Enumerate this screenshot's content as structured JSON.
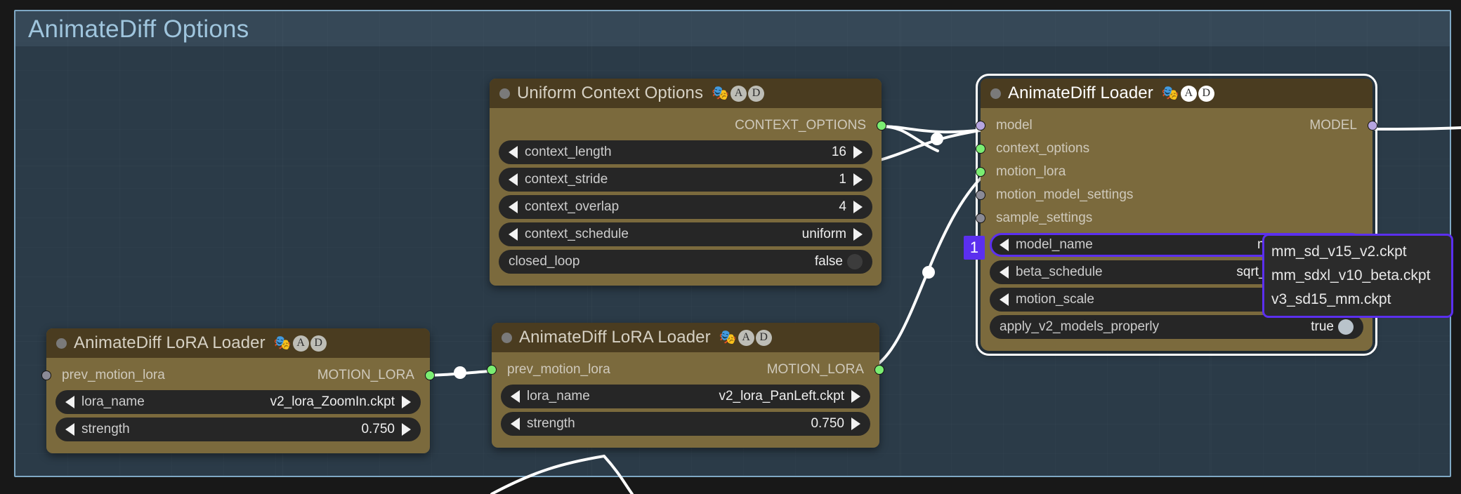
{
  "canvas": {
    "background_color": "#181818"
  },
  "group": {
    "title": "AnimateDiff Options",
    "border_color": "#7fa8c4",
    "fill_color": "#2b3b48"
  },
  "badges": {
    "masks": "🎭",
    "a": "A",
    "d": "D"
  },
  "nodes": {
    "uniform_context_options": {
      "title": "Uniform Context Options",
      "outputs": [
        {
          "label": "CONTEXT_OPTIONS",
          "color": "#7bee72"
        }
      ],
      "widgets": [
        {
          "name": "context_length",
          "value": "16"
        },
        {
          "name": "context_stride",
          "value": "1"
        },
        {
          "name": "context_overlap",
          "value": "4"
        },
        {
          "name": "context_schedule",
          "value": "uniform"
        },
        {
          "name": "closed_loop",
          "value": "false",
          "type": "toggle",
          "state": "off"
        }
      ]
    },
    "animatediff_loader": {
      "title": "AnimateDiff Loader",
      "selected": true,
      "inputs": [
        {
          "label": "model",
          "color": "#b6a5e0",
          "connected": true
        },
        {
          "label": "context_options",
          "color": "#7bee72",
          "connected": true
        },
        {
          "label": "motion_lora",
          "color": "#7bee72",
          "connected": true
        },
        {
          "label": "motion_model_settings",
          "color": "#8a8a96",
          "connected": false
        },
        {
          "label": "sample_settings",
          "color": "#8a8a96",
          "connected": false
        }
      ],
      "outputs": [
        {
          "label": "MODEL",
          "color": "#b6a5e0"
        }
      ],
      "widgets": [
        {
          "name": "model_name",
          "value": "mm_sd_v15_",
          "highlighted": true
        },
        {
          "name": "beta_schedule",
          "value": "sqrt_linear (Anim"
        },
        {
          "name": "motion_scale",
          "value": ""
        },
        {
          "name": "apply_v2_models_properly",
          "value": "true",
          "type": "toggle",
          "state": "on"
        }
      ],
      "marker_badge": "1"
    },
    "lora_loader_left": {
      "title": "AnimateDiff LoRA Loader",
      "inputs": [
        {
          "label": "prev_motion_lora",
          "color": "#8a8a96",
          "connected": false
        }
      ],
      "outputs": [
        {
          "label": "MOTION_LORA",
          "color": "#7bee72"
        }
      ],
      "widgets": [
        {
          "name": "lora_name",
          "value": "v2_lora_ZoomIn.ckpt"
        },
        {
          "name": "strength",
          "value": "0.750"
        }
      ]
    },
    "lora_loader_right": {
      "title": "AnimateDiff LoRA Loader",
      "inputs": [
        {
          "label": "prev_motion_lora",
          "color": "#7bee72",
          "connected": true
        }
      ],
      "outputs": [
        {
          "label": "MOTION_LORA",
          "color": "#7bee72"
        }
      ],
      "widgets": [
        {
          "name": "lora_name",
          "value": "v2_lora_PanLeft.ckpt"
        },
        {
          "name": "strength",
          "value": "0.750"
        }
      ]
    }
  },
  "dropdown": {
    "border_color": "#5b2fef",
    "items": [
      "mm_sd_v15_v2.ckpt",
      "mm_sdxl_v10_beta.ckpt",
      "v3_sd15_mm.ckpt"
    ]
  }
}
